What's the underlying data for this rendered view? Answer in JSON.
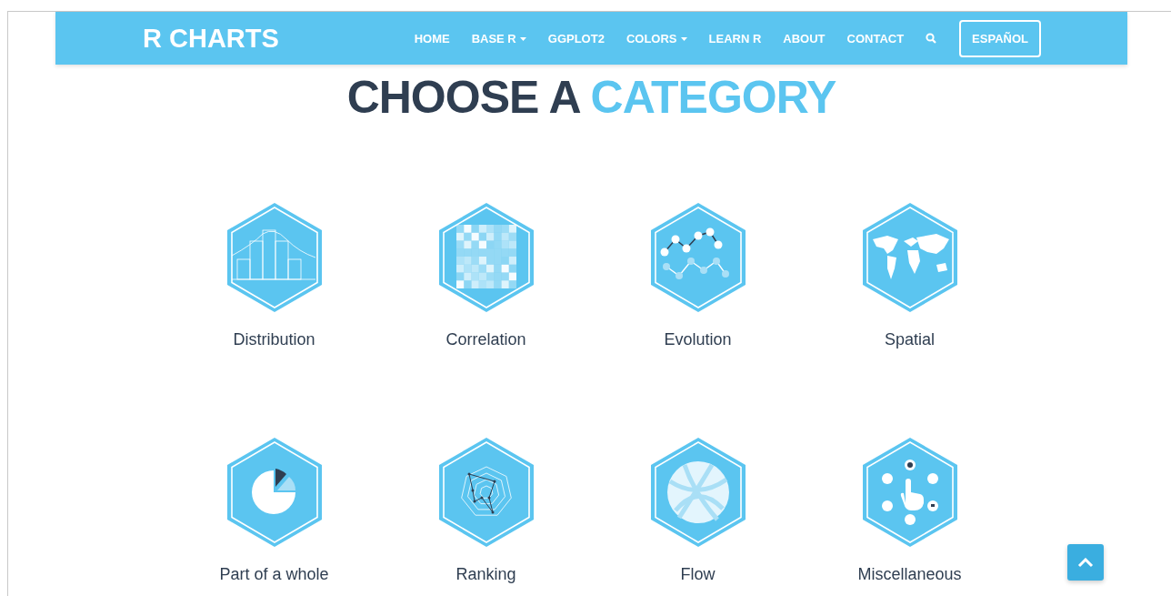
{
  "brand": "R CHARTS",
  "nav": [
    {
      "label": "HOME",
      "dropdown": false
    },
    {
      "label": "BASE R",
      "dropdown": true
    },
    {
      "label": "GGPLOT2",
      "dropdown": false
    },
    {
      "label": "COLORS",
      "dropdown": true
    },
    {
      "label": "LEARN R",
      "dropdown": false
    },
    {
      "label": "ABOUT",
      "dropdown": false
    },
    {
      "label": "CONTACT",
      "dropdown": false
    }
  ],
  "language_button": "ESPAÑOL",
  "heading": {
    "lead": "CHOOSE A",
    "accent": "CATEGORY"
  },
  "categories": [
    {
      "label": "Distribution",
      "kind": "distribution"
    },
    {
      "label": "Correlation",
      "kind": "correlation"
    },
    {
      "label": "Evolution",
      "kind": "evolution"
    },
    {
      "label": "Spatial",
      "kind": "spatial"
    },
    {
      "label": "Part of a whole",
      "kind": "part"
    },
    {
      "label": "Ranking",
      "kind": "ranking"
    },
    {
      "label": "Flow",
      "kind": "flow"
    },
    {
      "label": "Miscellaneous",
      "kind": "misc"
    }
  ]
}
